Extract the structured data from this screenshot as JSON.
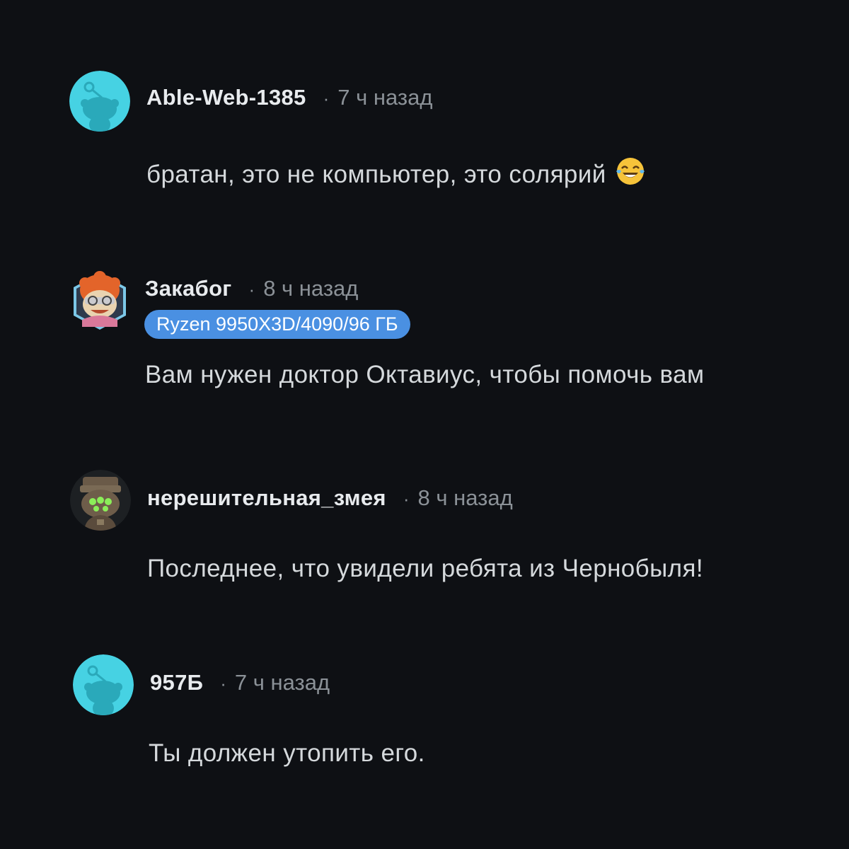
{
  "colors": {
    "background": "#0e1014",
    "username": "#e8ebee",
    "meta": "#8b9197",
    "body": "#d5d9dc",
    "flair": "#4a90e2",
    "default_avatar": "#46d2e3"
  },
  "comments": [
    {
      "username": "Able-Web-1385",
      "separator": "·",
      "time": "7 ч назад",
      "text": "братан, это не компьютер, это солярий",
      "emoji": "face-with-tears-of-joy-icon",
      "avatar": "default-snoo-avatar-icon"
    },
    {
      "username": "Закабог",
      "separator": "·",
      "time": "8 ч назад",
      "flair": "Ryzen 9950X3D/4090/96 ГБ",
      "text": "Вам нужен доктор Октавиус, чтобы помочь вам",
      "avatar": "custom-snoo-avatar-icon"
    },
    {
      "username": "нерешительная_змея",
      "separator": "·",
      "time": "8 ч назад",
      "text": "Последнее, что увидели ребята из Чернобыля!",
      "avatar": "robot-snoo-avatar-icon"
    },
    {
      "username": "957Б",
      "separator": "·",
      "time": "7 ч назад",
      "text": "Ты должен утопить его.",
      "avatar": "default-snoo-avatar-icon"
    }
  ]
}
